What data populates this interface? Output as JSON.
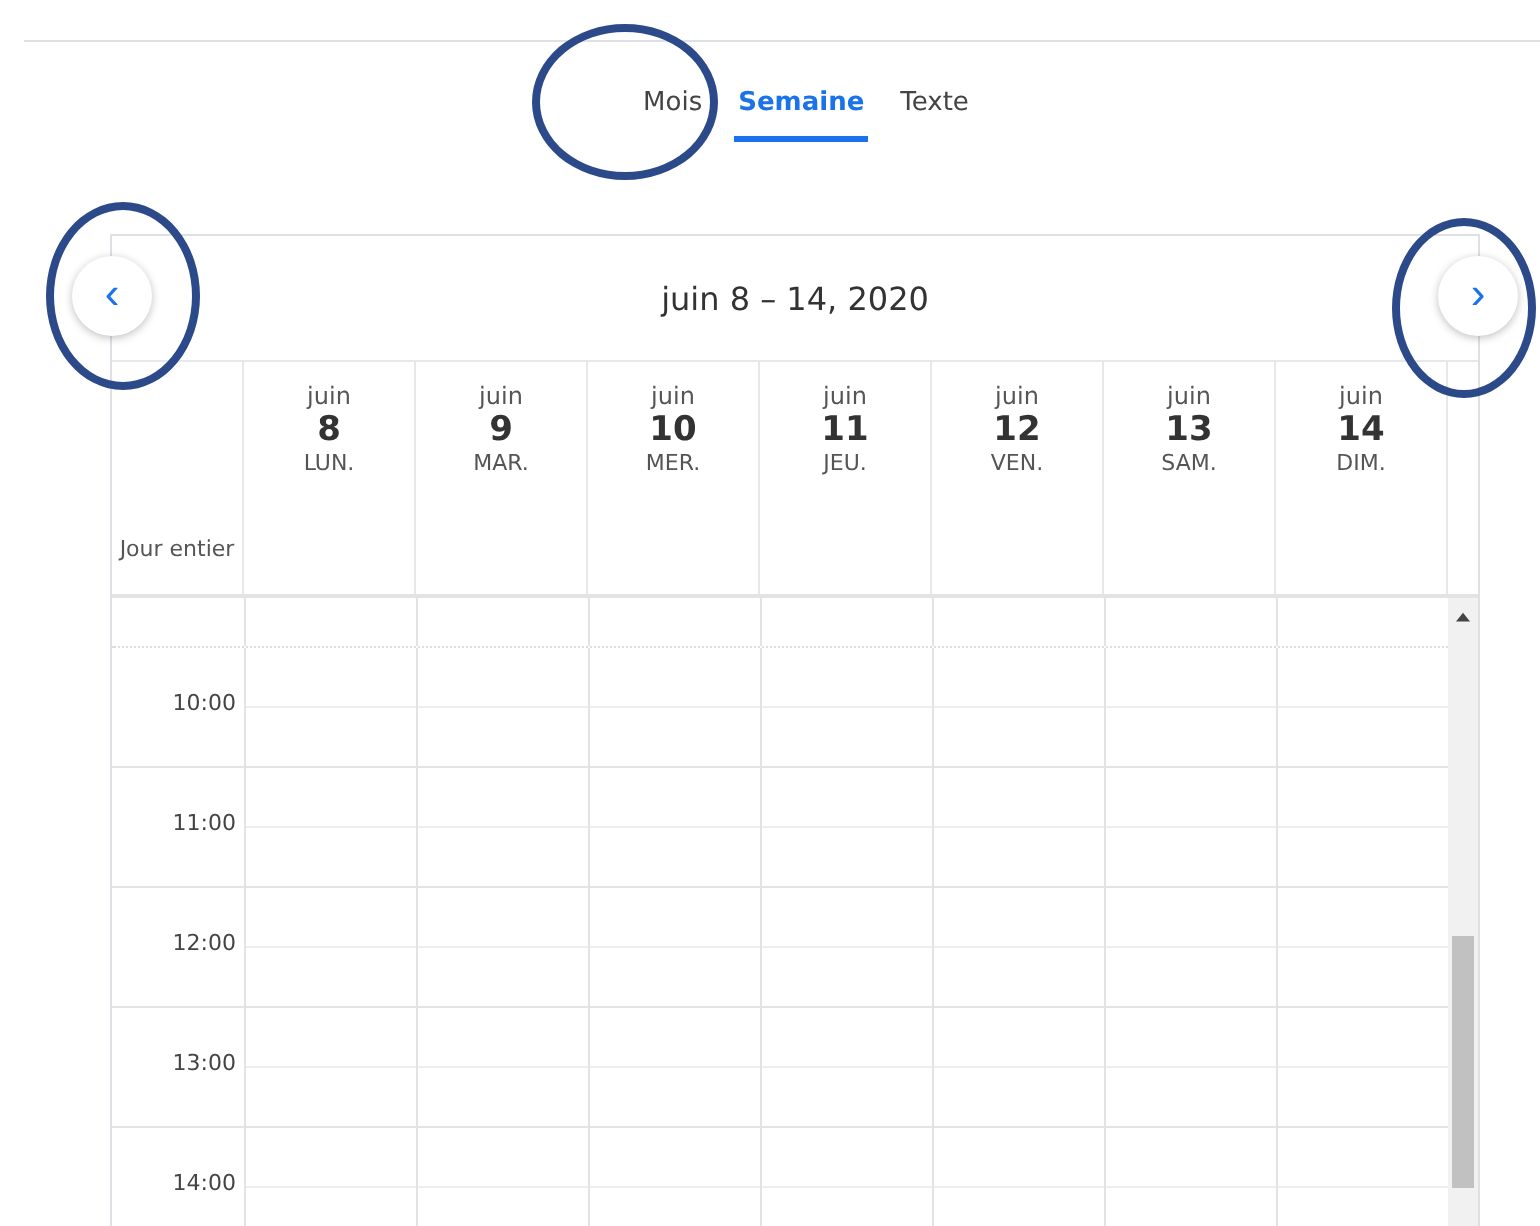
{
  "tabs": [
    {
      "label": "Mois",
      "selected": false
    },
    {
      "label": "Semaine",
      "selected": true
    },
    {
      "label": "Texte",
      "selected": false
    }
  ],
  "calendar": {
    "title": "juin 8 – 14, 2020",
    "prev_button": "‹",
    "next_button": "›",
    "all_day_label": "Jour entier",
    "days": [
      {
        "month": "juin",
        "date": "8",
        "weekday": "LUN."
      },
      {
        "month": "juin",
        "date": "9",
        "weekday": "MAR."
      },
      {
        "month": "juin",
        "date": "10",
        "weekday": "MER."
      },
      {
        "month": "juin",
        "date": "11",
        "weekday": "JEU."
      },
      {
        "month": "juin",
        "date": "12",
        "weekday": "VEN."
      },
      {
        "month": "juin",
        "date": "13",
        "weekday": "SAM."
      },
      {
        "month": "juin",
        "date": "14",
        "weekday": "DIM."
      }
    ],
    "hours": [
      "10:00",
      "11:00",
      "12:00",
      "13:00",
      "14:00"
    ]
  },
  "annotations": [
    {
      "kind": "tab_circle"
    },
    {
      "kind": "prev_circle"
    },
    {
      "kind": "next_circle"
    }
  ]
}
